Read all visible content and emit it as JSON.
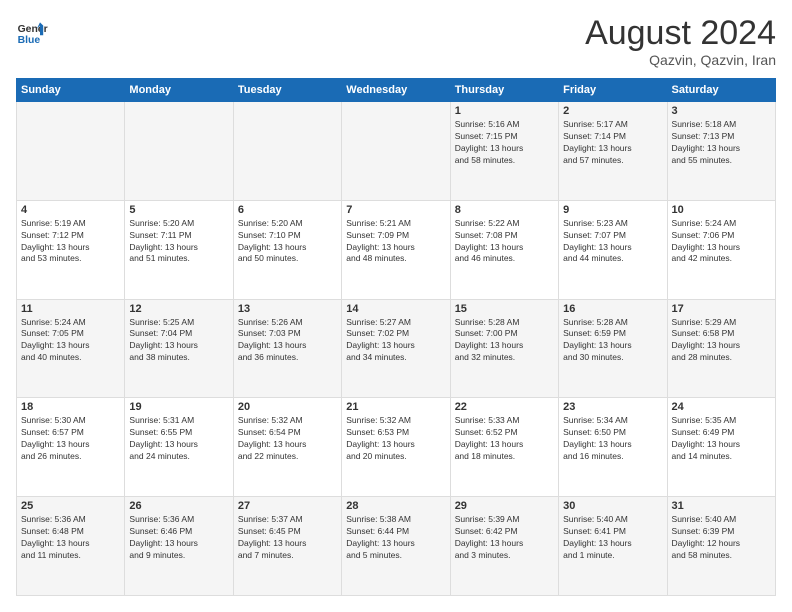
{
  "header": {
    "logo_line1": "General",
    "logo_line2": "Blue",
    "month_title": "August 2024",
    "location": "Qazvin, Qazvin, Iran"
  },
  "days_of_week": [
    "Sunday",
    "Monday",
    "Tuesday",
    "Wednesday",
    "Thursday",
    "Friday",
    "Saturday"
  ],
  "weeks": [
    [
      {
        "day": "",
        "info": ""
      },
      {
        "day": "",
        "info": ""
      },
      {
        "day": "",
        "info": ""
      },
      {
        "day": "",
        "info": ""
      },
      {
        "day": "1",
        "info": "Sunrise: 5:16 AM\nSunset: 7:15 PM\nDaylight: 13 hours\nand 58 minutes."
      },
      {
        "day": "2",
        "info": "Sunrise: 5:17 AM\nSunset: 7:14 PM\nDaylight: 13 hours\nand 57 minutes."
      },
      {
        "day": "3",
        "info": "Sunrise: 5:18 AM\nSunset: 7:13 PM\nDaylight: 13 hours\nand 55 minutes."
      }
    ],
    [
      {
        "day": "4",
        "info": "Sunrise: 5:19 AM\nSunset: 7:12 PM\nDaylight: 13 hours\nand 53 minutes."
      },
      {
        "day": "5",
        "info": "Sunrise: 5:20 AM\nSunset: 7:11 PM\nDaylight: 13 hours\nand 51 minutes."
      },
      {
        "day": "6",
        "info": "Sunrise: 5:20 AM\nSunset: 7:10 PM\nDaylight: 13 hours\nand 50 minutes."
      },
      {
        "day": "7",
        "info": "Sunrise: 5:21 AM\nSunset: 7:09 PM\nDaylight: 13 hours\nand 48 minutes."
      },
      {
        "day": "8",
        "info": "Sunrise: 5:22 AM\nSunset: 7:08 PM\nDaylight: 13 hours\nand 46 minutes."
      },
      {
        "day": "9",
        "info": "Sunrise: 5:23 AM\nSunset: 7:07 PM\nDaylight: 13 hours\nand 44 minutes."
      },
      {
        "day": "10",
        "info": "Sunrise: 5:24 AM\nSunset: 7:06 PM\nDaylight: 13 hours\nand 42 minutes."
      }
    ],
    [
      {
        "day": "11",
        "info": "Sunrise: 5:24 AM\nSunset: 7:05 PM\nDaylight: 13 hours\nand 40 minutes."
      },
      {
        "day": "12",
        "info": "Sunrise: 5:25 AM\nSunset: 7:04 PM\nDaylight: 13 hours\nand 38 minutes."
      },
      {
        "day": "13",
        "info": "Sunrise: 5:26 AM\nSunset: 7:03 PM\nDaylight: 13 hours\nand 36 minutes."
      },
      {
        "day": "14",
        "info": "Sunrise: 5:27 AM\nSunset: 7:02 PM\nDaylight: 13 hours\nand 34 minutes."
      },
      {
        "day": "15",
        "info": "Sunrise: 5:28 AM\nSunset: 7:00 PM\nDaylight: 13 hours\nand 32 minutes."
      },
      {
        "day": "16",
        "info": "Sunrise: 5:28 AM\nSunset: 6:59 PM\nDaylight: 13 hours\nand 30 minutes."
      },
      {
        "day": "17",
        "info": "Sunrise: 5:29 AM\nSunset: 6:58 PM\nDaylight: 13 hours\nand 28 minutes."
      }
    ],
    [
      {
        "day": "18",
        "info": "Sunrise: 5:30 AM\nSunset: 6:57 PM\nDaylight: 13 hours\nand 26 minutes."
      },
      {
        "day": "19",
        "info": "Sunrise: 5:31 AM\nSunset: 6:55 PM\nDaylight: 13 hours\nand 24 minutes."
      },
      {
        "day": "20",
        "info": "Sunrise: 5:32 AM\nSunset: 6:54 PM\nDaylight: 13 hours\nand 22 minutes."
      },
      {
        "day": "21",
        "info": "Sunrise: 5:32 AM\nSunset: 6:53 PM\nDaylight: 13 hours\nand 20 minutes."
      },
      {
        "day": "22",
        "info": "Sunrise: 5:33 AM\nSunset: 6:52 PM\nDaylight: 13 hours\nand 18 minutes."
      },
      {
        "day": "23",
        "info": "Sunrise: 5:34 AM\nSunset: 6:50 PM\nDaylight: 13 hours\nand 16 minutes."
      },
      {
        "day": "24",
        "info": "Sunrise: 5:35 AM\nSunset: 6:49 PM\nDaylight: 13 hours\nand 14 minutes."
      }
    ],
    [
      {
        "day": "25",
        "info": "Sunrise: 5:36 AM\nSunset: 6:48 PM\nDaylight: 13 hours\nand 11 minutes."
      },
      {
        "day": "26",
        "info": "Sunrise: 5:36 AM\nSunset: 6:46 PM\nDaylight: 13 hours\nand 9 minutes."
      },
      {
        "day": "27",
        "info": "Sunrise: 5:37 AM\nSunset: 6:45 PM\nDaylight: 13 hours\nand 7 minutes."
      },
      {
        "day": "28",
        "info": "Sunrise: 5:38 AM\nSunset: 6:44 PM\nDaylight: 13 hours\nand 5 minutes."
      },
      {
        "day": "29",
        "info": "Sunrise: 5:39 AM\nSunset: 6:42 PM\nDaylight: 13 hours\nand 3 minutes."
      },
      {
        "day": "30",
        "info": "Sunrise: 5:40 AM\nSunset: 6:41 PM\nDaylight: 13 hours\nand 1 minute."
      },
      {
        "day": "31",
        "info": "Sunrise: 5:40 AM\nSunset: 6:39 PM\nDaylight: 12 hours\nand 58 minutes."
      }
    ]
  ]
}
